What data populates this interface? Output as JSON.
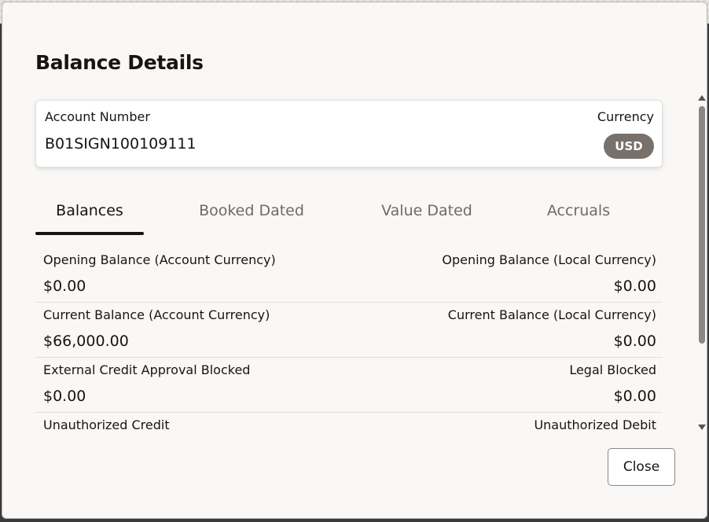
{
  "dialog": {
    "title": "Balance Details",
    "close_label": "Close"
  },
  "account": {
    "number_label": "Account Number",
    "number_value": "B01SIGN100109111",
    "currency_label": "Currency",
    "currency_value": "USD"
  },
  "tabs": [
    {
      "label": "Balances",
      "active": true
    },
    {
      "label": "Booked Dated",
      "active": false
    },
    {
      "label": "Value Dated",
      "active": false
    },
    {
      "label": "Accruals",
      "active": false
    }
  ],
  "balances": [
    {
      "left_label": "Opening Balance (Account Currency)",
      "left_value": "$0.00",
      "right_label": "Opening Balance (Local Currency)",
      "right_value": "$0.00"
    },
    {
      "left_label": "Current Balance (Account Currency)",
      "left_value": "$66,000.00",
      "right_label": "Current Balance (Local Currency)",
      "right_value": "$0.00"
    },
    {
      "left_label": "External Credit Approval Blocked",
      "left_value": "$0.00",
      "right_label": "Legal Blocked",
      "right_value": "$0.00"
    },
    {
      "left_label": "Unauthorized Credit",
      "left_value": "",
      "right_label": "Unauthorized Debit",
      "right_value": ""
    }
  ],
  "colors": {
    "currency_badge": "#78716b",
    "active_tab_underline": "#161513",
    "dialog_background": "#f9f8f6"
  }
}
